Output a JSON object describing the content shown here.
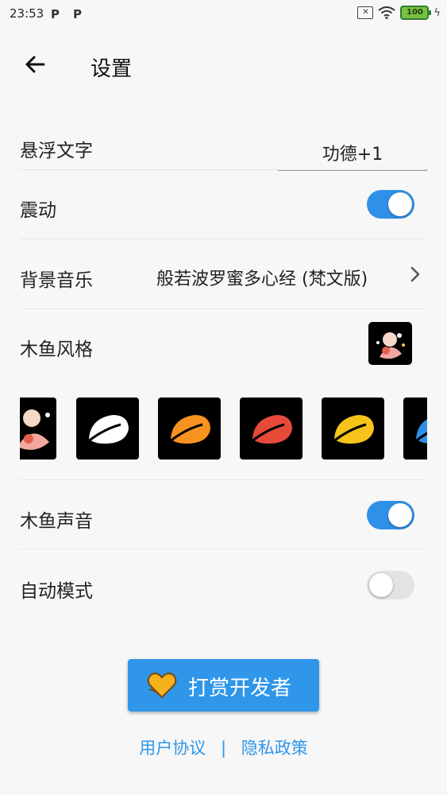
{
  "status_bar": {
    "time": "23:53",
    "notif_1": "P",
    "notif_2": "P",
    "sim_icon": "sim-x-icon",
    "battery": "100"
  },
  "appbar": {
    "title": "设置"
  },
  "settings": {
    "float_text": {
      "label": "悬浮文字",
      "value": "功德+1"
    },
    "vibration": {
      "label": "震动",
      "enabled": true
    },
    "bg_music": {
      "label": "背景音乐",
      "value": "般若波罗蜜多心经 (梵文版)"
    },
    "fish_style": {
      "label": "木鱼风格",
      "options": [
        {
          "name": "illustrated",
          "color": "#f3e3d0"
        },
        {
          "name": "white",
          "color": "#ffffff"
        },
        {
          "name": "orange",
          "color": "#f7931e"
        },
        {
          "name": "red",
          "color": "#e84a3a"
        },
        {
          "name": "yellow",
          "color": "#f6c31b"
        },
        {
          "name": "blue",
          "color": "#2d8fe6"
        }
      ]
    },
    "fish_sound": {
      "label": "木鱼声音",
      "enabled": true
    },
    "auto_mode": {
      "label": "自动模式",
      "enabled": false
    }
  },
  "reward_button": {
    "label": "打赏开发者"
  },
  "footer": {
    "user_agreement": "用户协议",
    "separator": "|",
    "privacy_policy": "隐私政策"
  },
  "colors": {
    "accent": "#2f96ea",
    "switch_on": "#2f90e8"
  }
}
